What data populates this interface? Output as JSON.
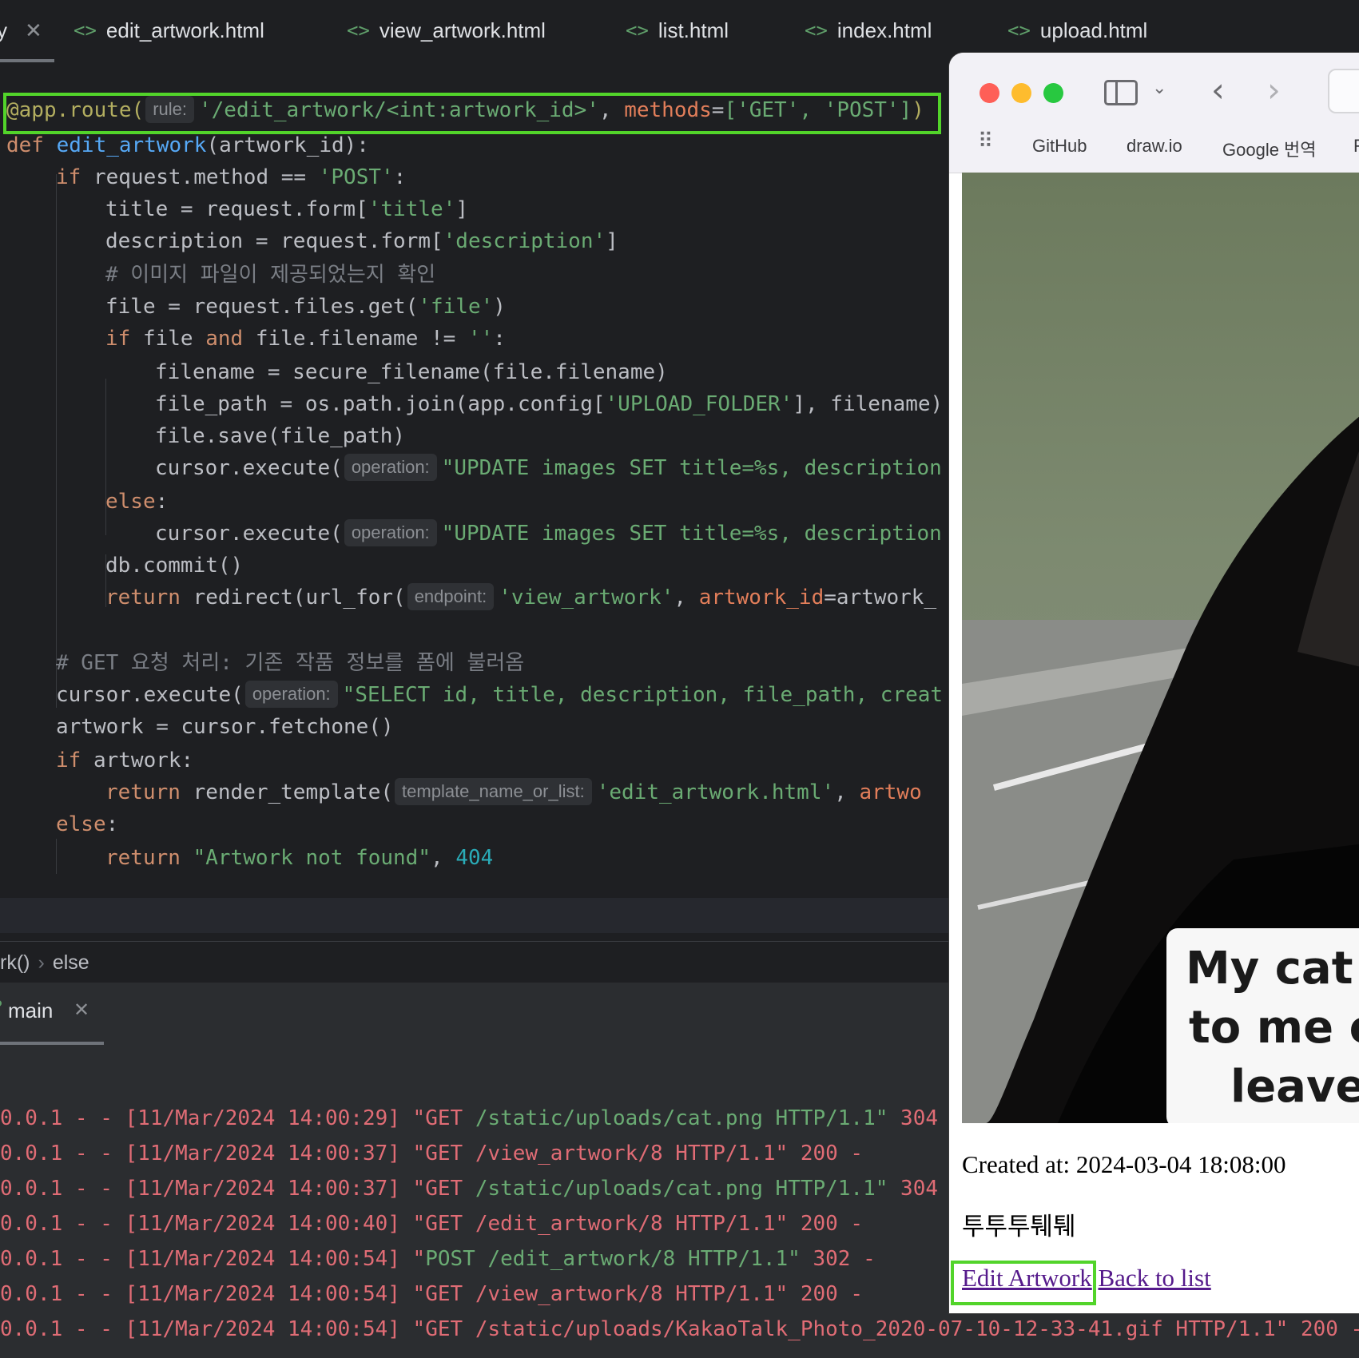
{
  "tabs": [
    {
      "label": "edit_artwork.html",
      "icon": "html-file-icon"
    },
    {
      "label": "view_artwork.html",
      "icon": "html-file-icon"
    },
    {
      "label": "list.html",
      "icon": "html-file-icon"
    },
    {
      "label": "index.html",
      "icon": "html-file-icon"
    },
    {
      "label": "upload.html",
      "icon": "html-file-icon"
    }
  ],
  "tab_fragment": "y",
  "code": {
    "hints": {
      "rule": "rule:",
      "operation": "operation:",
      "endpoint": "endpoint:",
      "template": "template_name_or_list:"
    },
    "route_path": "'/edit_artwork/<int:artwork_id>'",
    "route_methods": "['GET', 'POST']",
    "func_name": "edit_artwork",
    "comment_image": "# 이미지 파일이 제공되었는지 확인",
    "comment_get": "# GET 요청 처리: 기존 작품 정보를 폼에 불러옴",
    "sql_update": "\"UPDATE images SET title=%s, description",
    "sql_select": "\"SELECT id, title, description, file_path, creat",
    "upload_folder": "'UPLOAD_FOLDER'",
    "view_endpoint": "'view_artwork'",
    "template_file": "'edit_artwork.html'",
    "not_found": "\"Artwork not found\"",
    "not_found_code": "404"
  },
  "breadcrumb": {
    "func": "rk()",
    "block": "else"
  },
  "run_tab": {
    "label": "main"
  },
  "log_lines": [
    {
      "prefix": "0.0.1 - - [11/Mar/2024 14:00:29] \"GET ",
      "path": "/static/uploads/cat.png HTTP/1.1\"",
      "suffix": " 304 -"
    },
    {
      "prefix": "0.0.1 - - [11/Mar/2024 14:00:37] \"GET /view_artwork/8 HTTP/1.1\" 200 -",
      "path": "",
      "suffix": ""
    },
    {
      "prefix": "0.0.1 - - [11/Mar/2024 14:00:37] \"GET ",
      "path": "/static/uploads/cat.png HTTP/1.1\"",
      "suffix": " 304 -"
    },
    {
      "prefix": "0.0.1 - - [11/Mar/2024 14:00:40] \"GET /edit_artwork/8 HTTP/1.1\" 200 -",
      "path": "",
      "suffix": ""
    },
    {
      "prefix": "0.0.1 - - [11/Mar/2024 14:00:54] \"",
      "path": "POST /edit_artwork/8 HTTP/1.1\"",
      "suffix": " 302 -"
    },
    {
      "prefix": "0.0.1 - - [11/Mar/2024 14:00:54] \"GET /view_artwork/8 HTTP/1.1\" 200 -",
      "path": "",
      "suffix": ""
    },
    {
      "prefix": "0.0.1 - - [11/Mar/2024 14:00:54] \"GET /static/uploads/KakaoTalk_Photo_2020-07-10-12-33-41.gif HTTP/1.1\" 200 -",
      "path": "",
      "suffix": ""
    }
  ],
  "browser": {
    "bookmarks": [
      "GitHub",
      "draw.io",
      "Google 번역",
      "F"
    ],
    "image_caption": [
      "My cat w",
      "to me ev",
      "leave"
    ],
    "created_at": "Created at: 2024-03-04 18:08:00",
    "description": "투투투퉤퉤",
    "edit_link": "Edit Artwork",
    "back_link": "Back to list"
  },
  "colors": {
    "highlight": "#52d42a",
    "editor_bg": "#1e1f22",
    "keyword": "#cf8e6d",
    "string": "#6aab73",
    "function": "#56a8f5",
    "log_text": "#e06c75"
  }
}
